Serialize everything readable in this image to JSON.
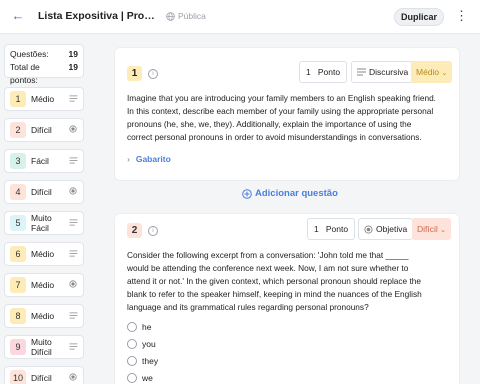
{
  "header": {
    "back_icon": "arrow-left-icon",
    "title": "Lista Expositiva | Pronomes Pessoais",
    "visibility_icon": "globe-icon",
    "visibility": "Pública",
    "duplicate_label": "Duplicar",
    "menu_icon": "kebab-icon"
  },
  "summary": {
    "questions_label": "Questões:",
    "questions_value": "19",
    "points_label": "Total de pontos:",
    "points_value": "19"
  },
  "sidebar_items": [
    {
      "num": "1",
      "difficulty": "Médio",
      "icon": "text-lines-icon",
      "color": "#fdecb8"
    },
    {
      "num": "2",
      "difficulty": "Difícil",
      "icon": "radio-icon",
      "color": "#fde3da"
    },
    {
      "num": "3",
      "difficulty": "Fácil",
      "icon": "text-lines-icon",
      "color": "#d8f2ea"
    },
    {
      "num": "4",
      "difficulty": "Difícil",
      "icon": "radio-icon",
      "color": "#fde3da"
    },
    {
      "num": "5",
      "difficulty": "Muito Fácil",
      "icon": "text-lines-icon",
      "color": "#dcf3f7"
    },
    {
      "num": "6",
      "difficulty": "Médio",
      "icon": "text-lines-icon",
      "color": "#fdecb8"
    },
    {
      "num": "7",
      "difficulty": "Médio",
      "icon": "radio-icon",
      "color": "#fdecb8"
    },
    {
      "num": "8",
      "difficulty": "Médio",
      "icon": "text-lines-icon",
      "color": "#fdecb8"
    },
    {
      "num": "9",
      "difficulty": "Muito Difícil",
      "icon": "text-lines-icon",
      "color": "#fbd7de"
    },
    {
      "num": "10",
      "difficulty": "Difícil",
      "icon": "radio-icon",
      "color": "#fde3da"
    }
  ],
  "question1": {
    "number": "1",
    "points_value": "1",
    "points_label": "Ponto",
    "type": "Discursiva",
    "difficulty": "Médio",
    "text_lines": [
      "Imagine that you are introducing your family members to an English speaking friend.",
      "In this context, describe each member of your family using the appropriate personal",
      "pronouns (he, she, we, they). Additionally, explain the importance of using the",
      "correct personal pronouns in order to avoid misunderstandings in conversations."
    ],
    "answer_key_label": "Gabarito"
  },
  "add_question_label": "Adicionar questão",
  "question2": {
    "number": "2",
    "points_value": "1",
    "points_label": "Ponto",
    "type": "Objetiva",
    "difficulty": "Difícil",
    "text_lines": [
      "Consider the following excerpt from a conversation: 'John told me that _____",
      "would be attending the conference next week. Now, I am not sure whether to",
      "attend it or not.' In the given context, which personal pronoun should replace the",
      "blank to refer to the speaker himself, keeping in mind the nuances of the English",
      "language and its grammatical rules regarding personal pronouns?"
    ],
    "options": [
      "he",
      "you",
      "they",
      "we"
    ]
  },
  "colors": {
    "accent": "#4a7fdc",
    "medio": "#fdecb8",
    "dificil": "#fde3da",
    "dificil_text": "#d9634a",
    "medio_text": "#b98a12"
  }
}
